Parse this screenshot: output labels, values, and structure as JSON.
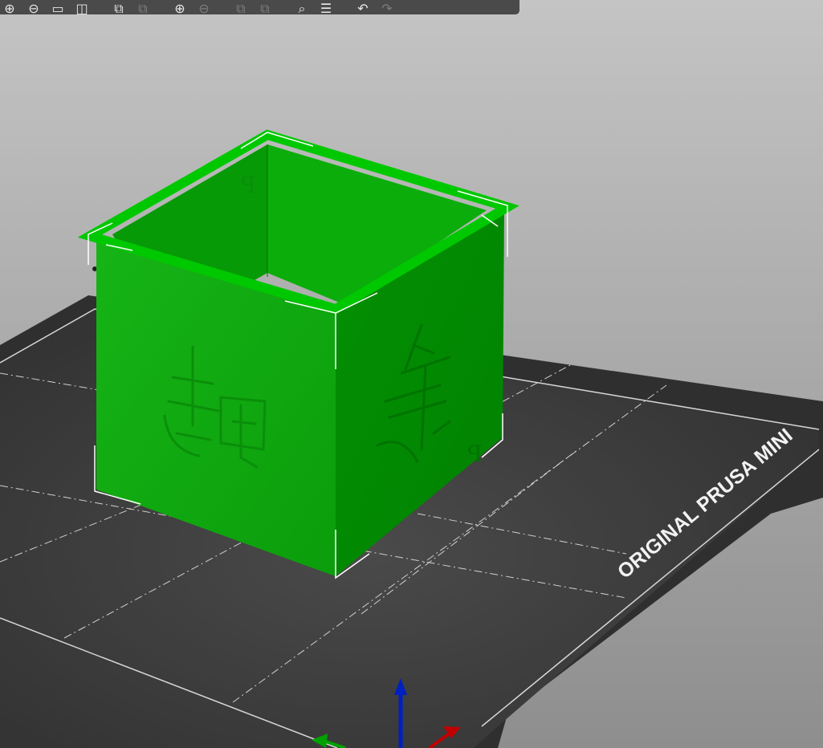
{
  "viewport": {
    "bed_label": "ORIGINAL PRUSA MINI"
  },
  "colors": {
    "background_top": "#c2c2c2",
    "bed": "#3a3a3a",
    "model_front": "#10a810",
    "model_right": "#048f04",
    "model_rim": "#00c000",
    "axis_x": "#c00000",
    "axis_y": "#00a000",
    "axis_z": "#0020c0"
  },
  "toolbar": {
    "buttons": [
      {
        "name": "add-icon",
        "glyph": "⊕",
        "enabled": true
      },
      {
        "name": "delete-icon",
        "glyph": "⊖",
        "enabled": true
      },
      {
        "name": "delete-all-icon",
        "glyph": "▭",
        "enabled": true
      },
      {
        "name": "arrange-icon",
        "glyph": "◫",
        "enabled": true
      },
      {
        "name": "copy-icon",
        "glyph": "⧉",
        "enabled": true
      },
      {
        "name": "paste-icon",
        "glyph": "⧉",
        "enabled": false
      },
      {
        "name": "add-instance-icon",
        "glyph": "⊕",
        "enabled": true
      },
      {
        "name": "remove-instance-icon",
        "glyph": "⊖",
        "enabled": false
      },
      {
        "name": "split-objects-icon",
        "glyph": "⧉",
        "enabled": false
      },
      {
        "name": "split-parts-icon",
        "glyph": "⧉",
        "enabled": false
      },
      {
        "name": "search-icon",
        "glyph": "⌕",
        "enabled": true
      },
      {
        "name": "layers-icon",
        "glyph": "☰",
        "enabled": true
      },
      {
        "name": "undo-icon",
        "glyph": "↶",
        "enabled": true
      },
      {
        "name": "redo-icon",
        "glyph": "↷",
        "enabled": false
      }
    ]
  }
}
